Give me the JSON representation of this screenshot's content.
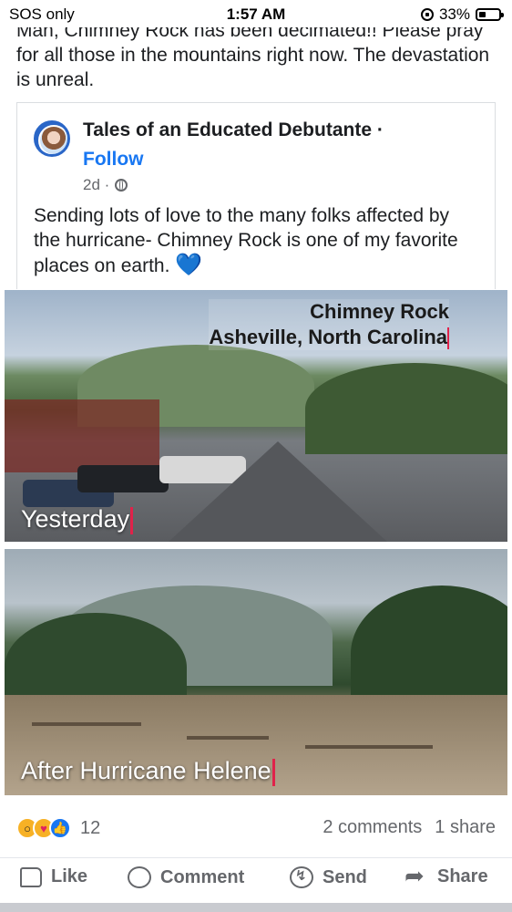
{
  "status_bar": {
    "carrier": "SOS only",
    "time": "1:57 AM",
    "battery": "33%",
    "battery_level": 0.33
  },
  "post": {
    "text": "Man, Chimney Rock has been decimated!! Please pray for all those in the mountains right now. The devastation is unreal."
  },
  "shared_post": {
    "page_name": "Tales of an Educated Debutante ·",
    "follow_label": "Follow",
    "time": "2d ·",
    "privacy_icon": "globe-icon",
    "text": "Sending lots of love to the many folks affected by the hurricane- Chimney Rock is one of my favorite places on earth.",
    "emoji": "💙"
  },
  "photos": {
    "top_title_line1": "Chimney Rock",
    "top_title_line2": "Asheville, North Carolina",
    "top_caption": "Yesterday",
    "bottom_caption": "After Hurricane Helene"
  },
  "engagement": {
    "reaction_icons": [
      "wow-icon",
      "care-icon",
      "like-icon"
    ],
    "reaction_count": "12",
    "comments": "2 comments",
    "shares": "1 share"
  },
  "actions": {
    "like": "Like",
    "comment": "Comment",
    "send": "Send",
    "share": "Share"
  }
}
